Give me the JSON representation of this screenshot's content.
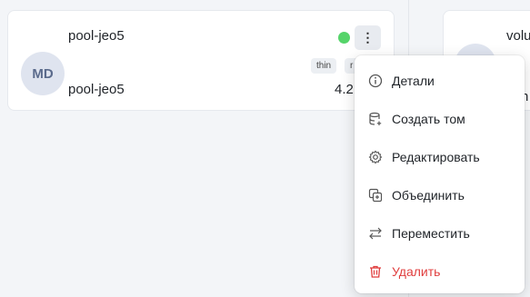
{
  "pool_card": {
    "avatar": "MD",
    "name": "pool-jeo5",
    "subtitle": "pool-jeo5",
    "tags": [
      "thin",
      "r"
    ],
    "size": "4.2",
    "status_color": "#55d46a",
    "kebab_icon": "⋮"
  },
  "next_card": {
    "title": "volu",
    "subtitle": "h",
    "icon": "pie-chart-icon"
  },
  "context_menu": {
    "items": [
      {
        "label": "Детали",
        "icon": "info-icon"
      },
      {
        "label": "Создать том",
        "icon": "database-plus-icon"
      },
      {
        "label": "Редактировать",
        "icon": "gear-icon"
      },
      {
        "label": "Объединить",
        "icon": "merge-icon"
      },
      {
        "label": "Переместить",
        "icon": "arrows-swap-icon"
      },
      {
        "label": "Удалить",
        "icon": "trash-icon",
        "color": "#e03e3e"
      }
    ]
  }
}
